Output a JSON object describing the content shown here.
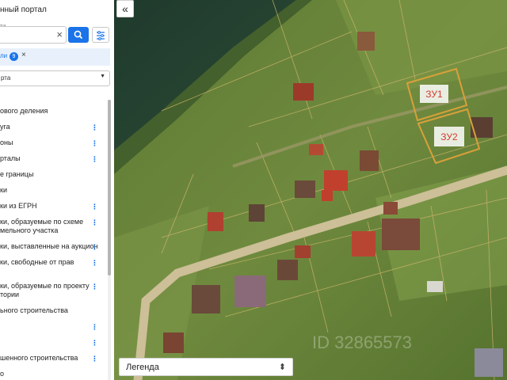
{
  "sidebar": {
    "portal_title": "нный портал",
    "search": {
      "caption": "ти",
      "value": ""
    },
    "chip": {
      "label": "ли",
      "count": "9",
      "close": "×"
    },
    "select_value": "рта",
    "layers": [
      {
        "label": "ового деления",
        "has_menu": false
      },
      {
        "label": "уга",
        "has_menu": true
      },
      {
        "label": "оны",
        "has_menu": true
      },
      {
        "label": "рталы",
        "has_menu": true
      },
      {
        "label": "е границы",
        "has_menu": false
      },
      {
        "label": "ки",
        "has_menu": false
      },
      {
        "label": "ки из ЕГРН",
        "has_menu": true
      },
      {
        "label": "ки, образуемые по схеме",
        "label2": "мельного участка",
        "has_menu": true
      },
      {
        "label": "ки, выставленные на аукцион",
        "has_menu": true
      },
      {
        "label": "ки, свободные от прав",
        "has_menu": true
      },
      {
        "label": "ки, образуемые по проекту",
        "label2": "тории",
        "has_menu": true
      },
      {
        "label": "ьного строительства",
        "has_menu": false
      },
      {
        "label": "",
        "has_menu": true
      },
      {
        "label": "",
        "has_menu": true
      },
      {
        "label": "шенного строительства",
        "has_menu": true
      },
      {
        "label": "о",
        "has_menu": false
      }
    ]
  },
  "map": {
    "plots": [
      {
        "label": "ЗУ1"
      },
      {
        "label": "ЗУ2"
      }
    ],
    "watermark": "ID 32865573",
    "plot_label_color": "#d63b2e",
    "plot_border_color": "#d9a03a"
  },
  "legend": {
    "label": "Легенда"
  },
  "colors": {
    "accent": "#1a73e8"
  }
}
